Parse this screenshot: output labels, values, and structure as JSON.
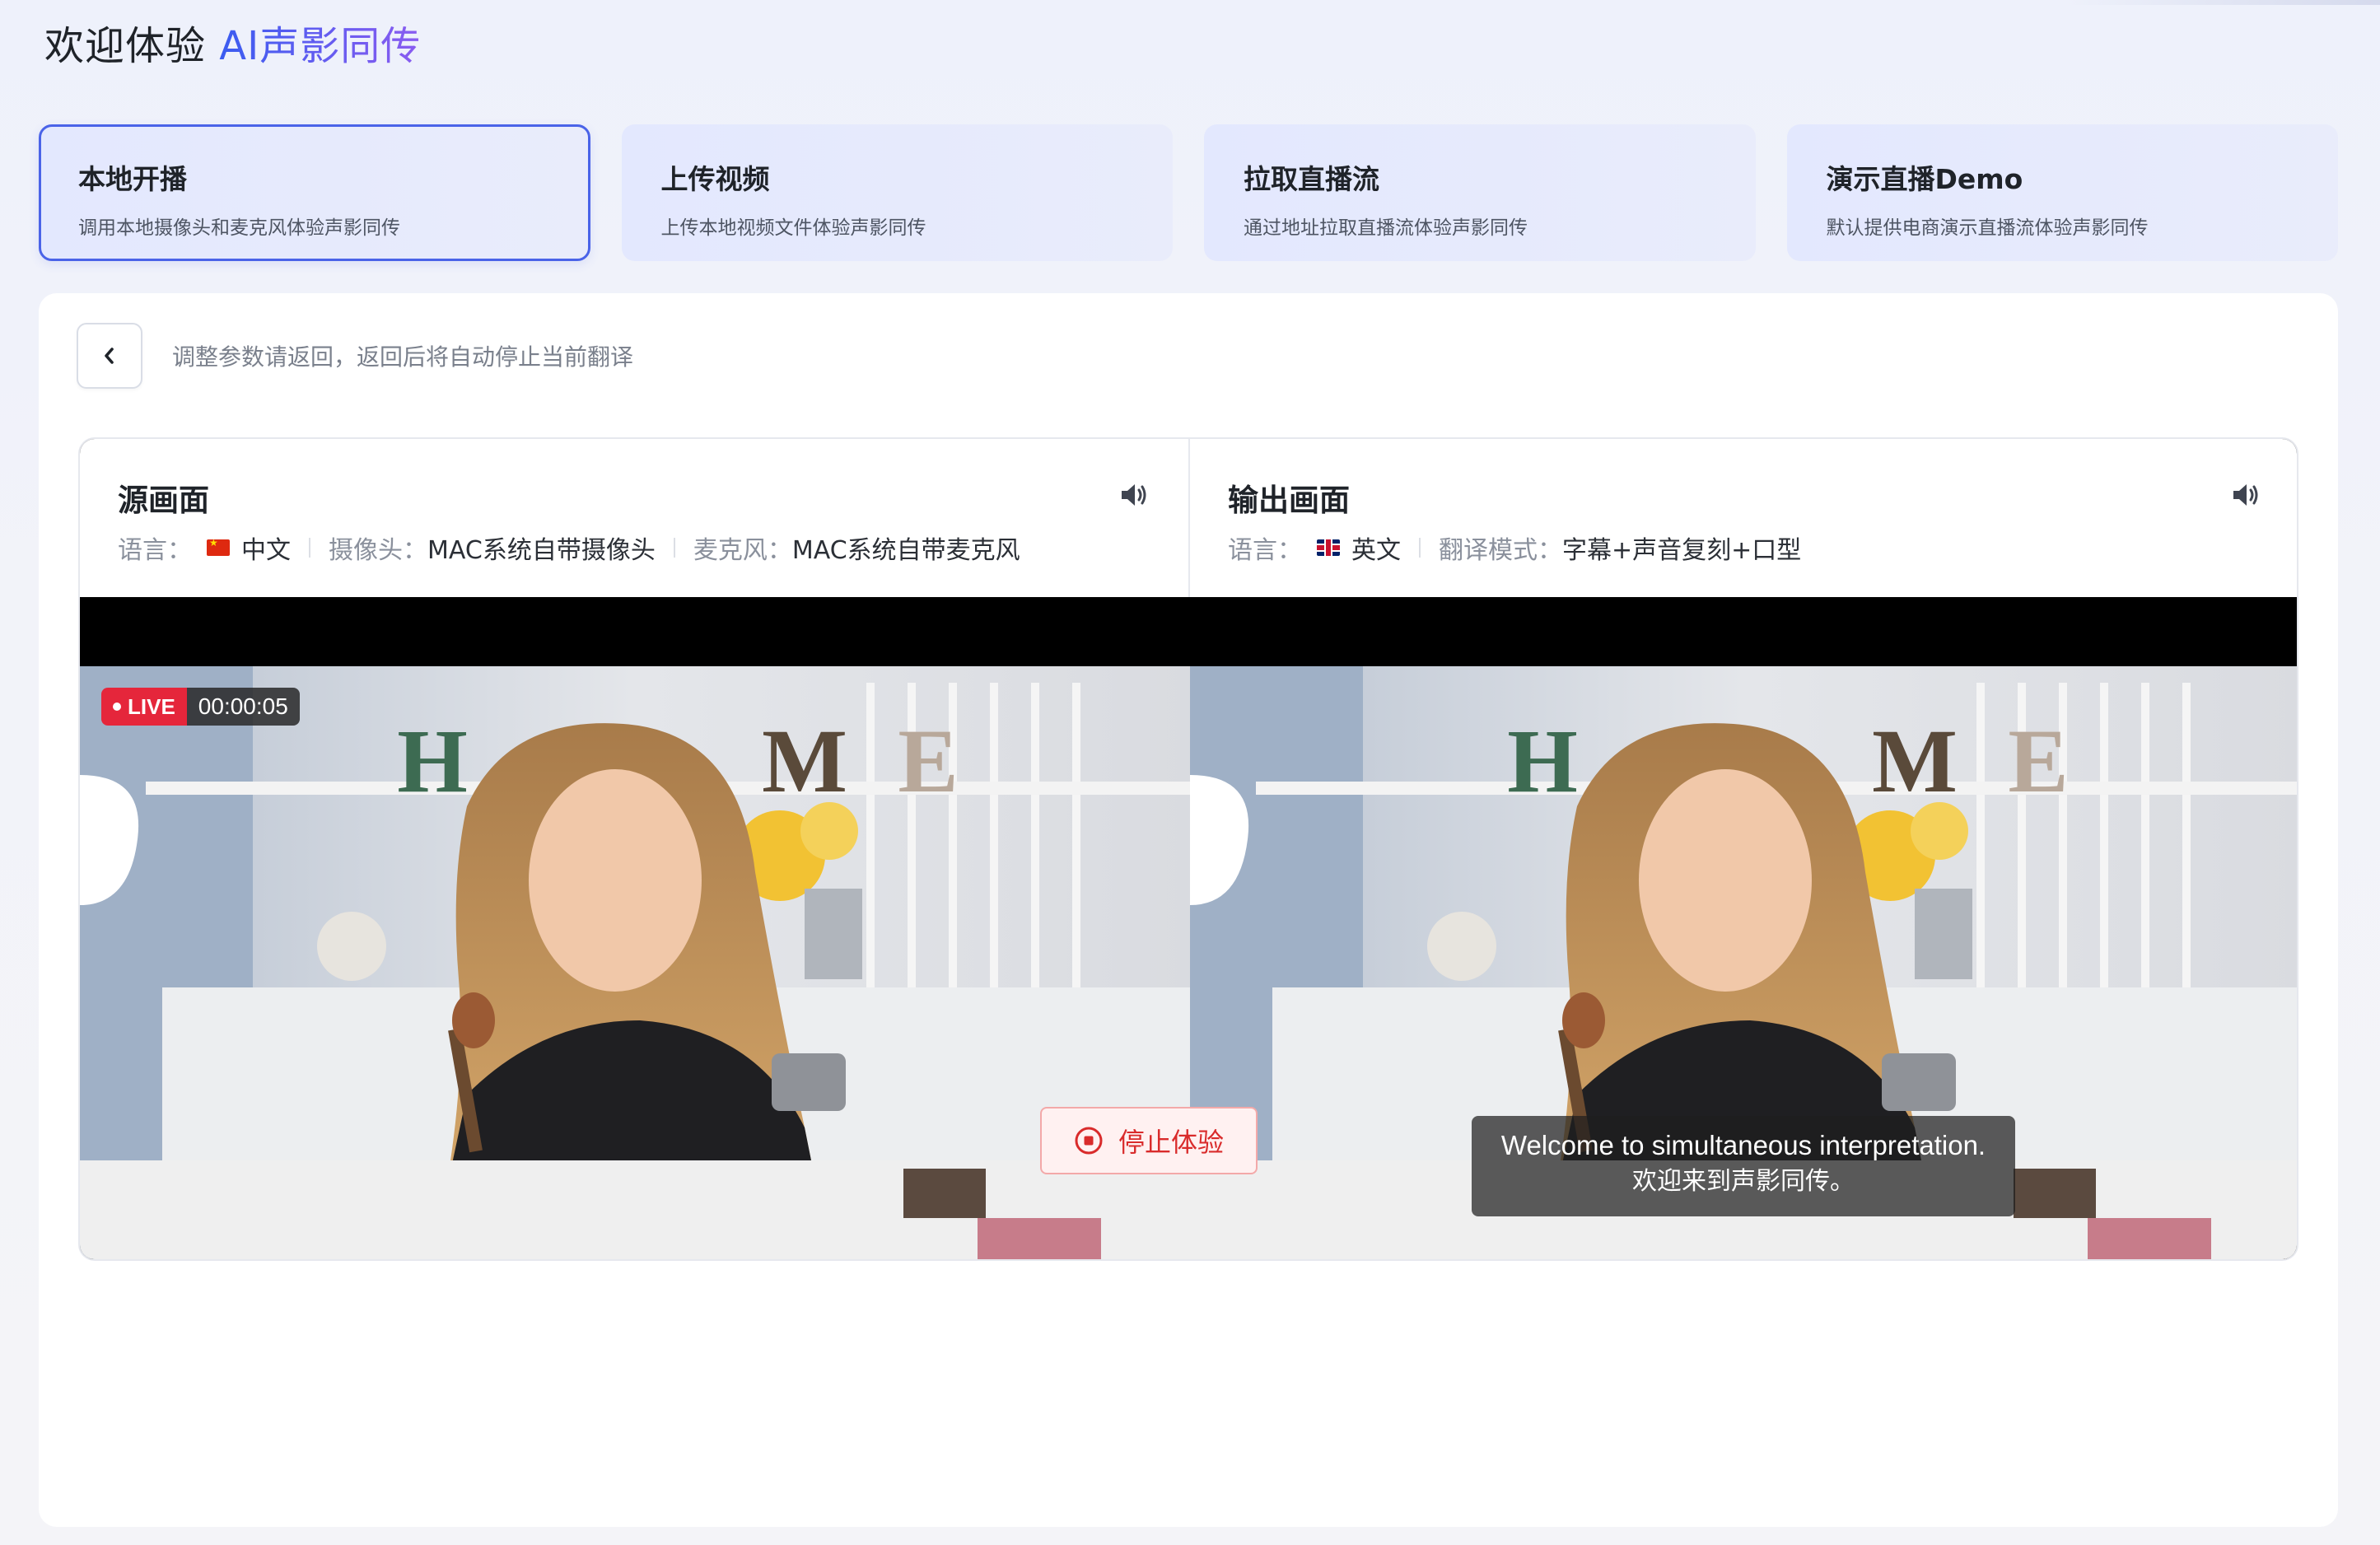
{
  "header": {
    "title_prefix": "欢迎体验 ",
    "title_brand": "AI声影同传"
  },
  "modes": [
    {
      "title": "本地开播",
      "desc": "调用本地摄像头和麦克风体验声影同传",
      "active": true
    },
    {
      "title": "上传视频",
      "desc": "上传本地视频文件体验声影同传",
      "active": false
    },
    {
      "title": "拉取直播流",
      "desc": "通过地址拉取直播流体验声影同传",
      "active": false
    },
    {
      "title": "演示直播Demo",
      "desc": "默认提供电商演示直播流体验声影同传",
      "active": false
    }
  ],
  "toolbar": {
    "back_hint": "调整参数请返回，返回后将自动停止当前翻译"
  },
  "source": {
    "title": "源画面",
    "lang_label": "语言：",
    "lang_value": "中文",
    "camera_label": "摄像头：",
    "camera_value": "MAC系统自带摄像头",
    "mic_label": "麦克风：",
    "mic_value": "MAC系统自带麦克风",
    "live_label": "LIVE",
    "elapsed": "00:00:05"
  },
  "output": {
    "title": "输出画面",
    "lang_label": "语言：",
    "lang_value": "英文",
    "mode_label": "翻译模式：",
    "mode_value": "字幕+声音复刻+口型",
    "subtitle_en": "Welcome to simultaneous interpretation.",
    "subtitle_zh": "欢迎来到声影同传。"
  },
  "actions": {
    "stop_label": "停止体验"
  },
  "colors": {
    "accent": "#4a63e8",
    "stop": "#d92b2b",
    "live": "#e5263b"
  }
}
